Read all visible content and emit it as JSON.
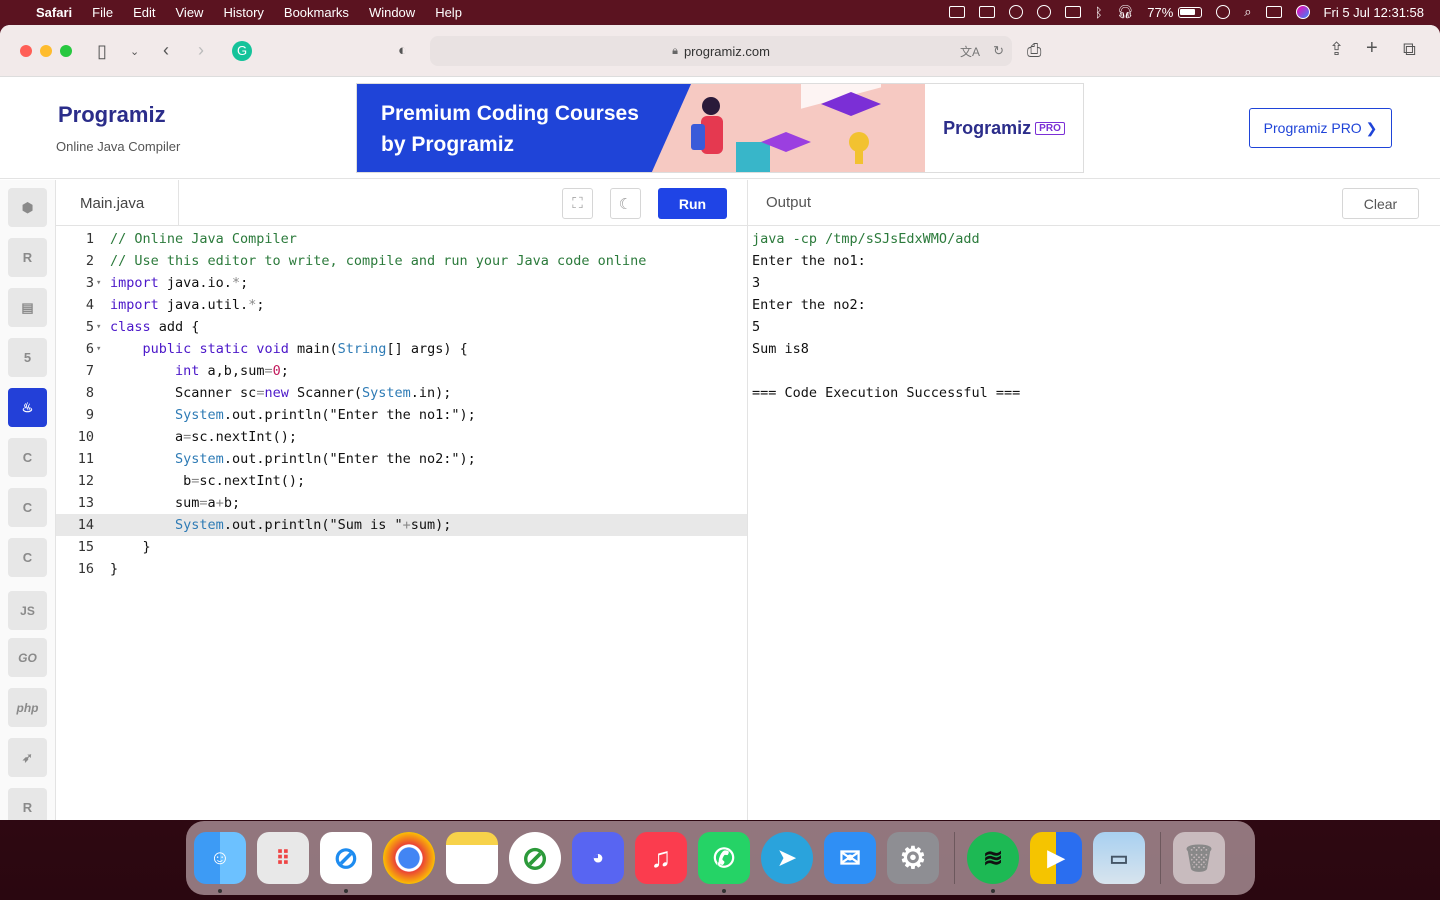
{
  "menubar": {
    "app": "Safari",
    "items": [
      "File",
      "Edit",
      "View",
      "History",
      "Bookmarks",
      "Window",
      "Help"
    ],
    "battery": "77%",
    "datetime": "Fri 5 Jul  12:31:58"
  },
  "browser": {
    "url": "programiz.com"
  },
  "site": {
    "logo": "Programiz",
    "subtitle": "Online Java Compiler",
    "banner_title": "Premium Coding Courses by Programiz",
    "banner_brand": "Programiz",
    "banner_badge": "PRO",
    "pro_button": "Programiz PRO ❯"
  },
  "sidebar": {
    "languages": [
      "python",
      "r",
      "sql",
      "html",
      "java",
      "c",
      "cpp",
      "csharp",
      "javascript",
      "go",
      "php",
      "swift",
      "rust"
    ],
    "labels": {
      "javascript": "JS",
      "go": "GO",
      "php": "php"
    },
    "active": "java"
  },
  "editor": {
    "filename": "Main.java",
    "run_label": "Run",
    "active_line": 14,
    "lines": [
      "// Online Java Compiler",
      "// Use this editor to write, compile and run your Java code online",
      "import java.io.*;",
      "import java.util.*;",
      "class add {",
      "    public static void main(String[] args) {",
      "        int a,b,sum=0;",
      "        Scanner sc=new Scanner(System.in);",
      "        System.out.println(\"Enter the no1:\");",
      "        a=sc.nextInt();",
      "        System.out.println(\"Enter the no2:\");",
      "         b=sc.nextInt();",
      "        sum=a+b;",
      "        System.out.println(\"Sum is \"+sum);",
      "    }",
      "}"
    ]
  },
  "output": {
    "title": "Output",
    "clear_label": "Clear",
    "lines": [
      "java -cp /tmp/sSJsEdxWMO/add",
      "Enter the no1:",
      "3",
      "Enter the no2:",
      "5",
      "Sum is8",
      "",
      "=== Code Execution Successful ==="
    ]
  },
  "dock": {
    "apps": [
      "finder",
      "launchpad",
      "safari",
      "chrome",
      "notes",
      "app-store-blocked",
      "discord",
      "music",
      "whatsapp",
      "telegram",
      "mail",
      "system-settings",
      "spotify",
      "preview-app",
      "photos",
      "trash"
    ]
  },
  "colors": {
    "accent": "#1f44e6",
    "brand": "#2b2d8a",
    "comment": "#2b7a3b",
    "keyword": "#4b17c9"
  }
}
